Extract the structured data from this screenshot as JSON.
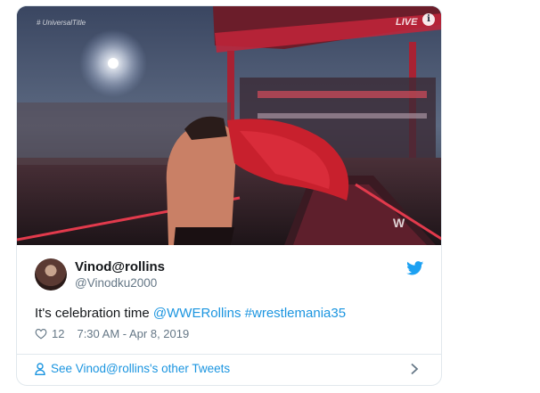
{
  "media": {
    "watermark": "# UniversalTitle",
    "live_label": "LIVE",
    "info_label": "i",
    "network_logo": "W"
  },
  "author": {
    "display_name": "Vinod@rollins",
    "handle": "@Vinodku2000"
  },
  "tweet": {
    "text_prefix": "It's celebration time ",
    "mention": "@WWERollins",
    "hashtag": "#wrestlemania35",
    "like_count": "12",
    "timestamp": "7:30 AM - Apr 8, 2019"
  },
  "footer": {
    "link_label": "See Vinod@rollins's other Tweets"
  },
  "colors": {
    "link": "#1b95e0",
    "muted": "#657786",
    "border": "#e1e8ed"
  },
  "icons": [
    "info-icon",
    "twitter-bird-icon",
    "heart-icon",
    "person-icon",
    "chevron-right-icon"
  ]
}
